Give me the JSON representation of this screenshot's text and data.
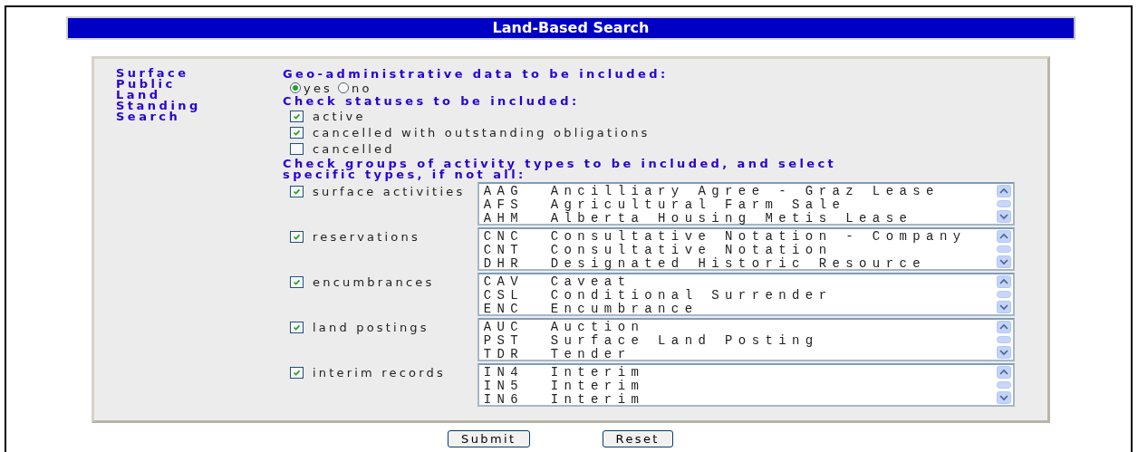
{
  "title": "Land-Based Search",
  "sidebar_label": "Surface Public Land Standing Search",
  "geo": {
    "heading": "Geo-administrative data to be included:",
    "options": [
      {
        "label": "yes",
        "selected": true
      },
      {
        "label": "no",
        "selected": false
      }
    ]
  },
  "statuses": {
    "heading": "Check statuses to be included:",
    "items": [
      {
        "label": "active",
        "checked": true
      },
      {
        "label": "cancelled with outstanding obligations",
        "checked": true
      },
      {
        "label": "cancelled",
        "checked": false
      }
    ]
  },
  "groups": {
    "heading": "Check groups of activity types to be included, and select specific types, if not all:",
    "items": [
      {
        "label": "surface activities",
        "checked": true,
        "options": [
          {
            "code": "AAG",
            "name": "Ancilliary Agree - Graz Lease"
          },
          {
            "code": "AFS",
            "name": "Agricultural Farm Sale"
          },
          {
            "code": "AHM",
            "name": "Alberta Housing Metis Lease"
          }
        ]
      },
      {
        "label": "reservations",
        "checked": true,
        "options": [
          {
            "code": "CNC",
            "name": "Consultative Notation - Company"
          },
          {
            "code": "CNT",
            "name": "Consultative Notation"
          },
          {
            "code": "DHR",
            "name": "Designated Historic Resource"
          }
        ]
      },
      {
        "label": "encumbrances",
        "checked": true,
        "options": [
          {
            "code": "CAV",
            "name": "Caveat"
          },
          {
            "code": "CSL",
            "name": "Conditional Surrender"
          },
          {
            "code": "ENC",
            "name": "Encumbrance"
          }
        ]
      },
      {
        "label": "land postings",
        "checked": true,
        "options": [
          {
            "code": "AUC",
            "name": "Auction"
          },
          {
            "code": "PST",
            "name": "Surface Land Posting"
          },
          {
            "code": "TDR",
            "name": "Tender"
          }
        ]
      },
      {
        "label": "interim records",
        "checked": true,
        "options": [
          {
            "code": "IN4",
            "name": "Interim"
          },
          {
            "code": "IN5",
            "name": "Interim"
          },
          {
            "code": "IN6",
            "name": "Interim"
          }
        ]
      }
    ]
  },
  "buttons": [
    "Submit",
    "Reset"
  ]
}
